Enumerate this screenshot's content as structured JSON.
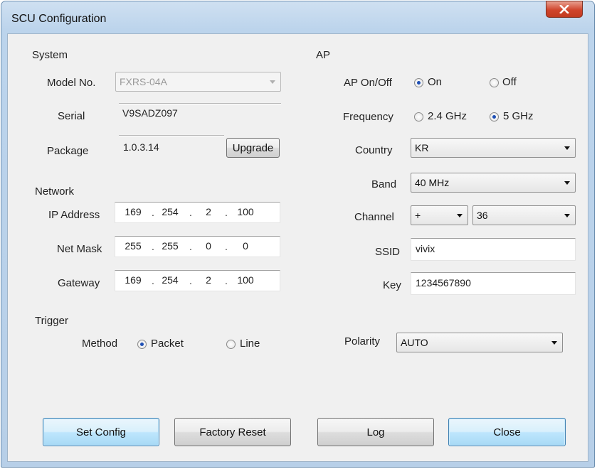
{
  "window": {
    "title": "SCU Configuration"
  },
  "system": {
    "header": "System",
    "model_label": "Model No.",
    "model_value": "FXRS-04A",
    "serial_label": "Serial",
    "serial_value": "V9SADZ097",
    "package_label": "Package",
    "package_value": "1.0.3.14",
    "upgrade_button": "Upgrade"
  },
  "network": {
    "header": "Network",
    "ip_label": "IP Address",
    "ip": [
      "169",
      "254",
      "2",
      "100"
    ],
    "mask_label": "Net Mask",
    "mask": [
      "255",
      "255",
      "0",
      "0"
    ],
    "gateway_label": "Gateway",
    "gateway": [
      "169",
      "254",
      "2",
      "100"
    ]
  },
  "trigger": {
    "header": "Trigger",
    "method_label": "Method",
    "packet_label": "Packet",
    "line_label": "Line",
    "selected": "Packet"
  },
  "ap": {
    "header": "AP",
    "onoff_label": "AP On/Off",
    "on_label": "On",
    "off_label": "Off",
    "onoff_selected": "On",
    "frequency_label": "Frequency",
    "freq_24_label": "2.4 GHz",
    "freq_5_label": "5 GHz",
    "frequency_selected": "5 GHz",
    "country_label": "Country",
    "country_value": "KR",
    "band_label": "Band",
    "band_value": "40 MHz",
    "channel_label": "Channel",
    "channel_sign": "+",
    "channel_value": "36",
    "ssid_label": "SSID",
    "ssid_value": "vivix",
    "key_label": "Key",
    "key_value": "1234567890"
  },
  "polarity": {
    "label": "Polarity",
    "value": "AUTO"
  },
  "buttons": {
    "set_config": "Set Config",
    "factory_reset": "Factory Reset",
    "log": "Log",
    "close": "Close"
  },
  "colors": {
    "title_gradient_top": "#cfe0f1",
    "close_button": "#d0452c",
    "focused_button": "#bee6fd",
    "radio_dot": "#1e4fb4"
  }
}
